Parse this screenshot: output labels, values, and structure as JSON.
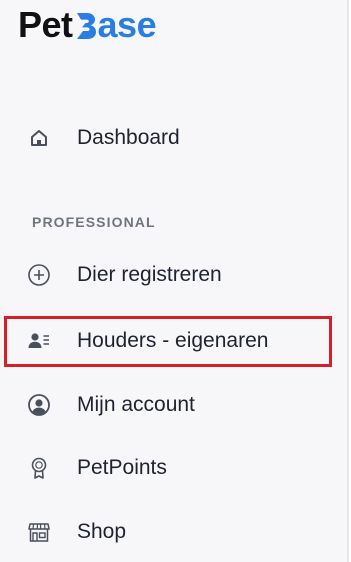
{
  "logo": {
    "part1": "Pet",
    "part2": "ase"
  },
  "nav": {
    "dashboard": "Dashboard",
    "section_professional": "PROFESSIONAL",
    "register_animal": "Dier registreren",
    "owners": "Houders - eigenaren",
    "my_account": "Mijn account",
    "petpoints": "PetPoints",
    "shop": "Shop"
  },
  "colors": {
    "brand_dark": "#111114",
    "brand_blue": "#2a7de1",
    "highlight_border": "#d61f26",
    "sidebar_bg": "#f7f7f9"
  },
  "highlighted_item": "owners"
}
